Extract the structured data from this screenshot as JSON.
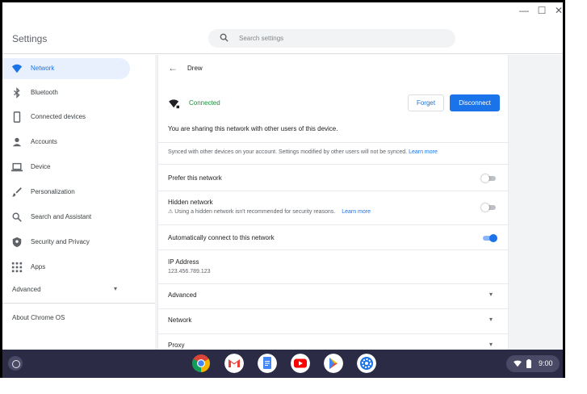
{
  "window": {
    "minimize_glyph": "—",
    "maximize_glyph": "☐",
    "close_glyph": "✕"
  },
  "header": {
    "title": "Settings",
    "search_placeholder": "Search settings"
  },
  "sidebar": {
    "items": [
      {
        "label": "Network",
        "icon": "wifi-icon",
        "active": true
      },
      {
        "label": "Bluetooth",
        "icon": "bluetooth-icon"
      },
      {
        "label": "Connected devices",
        "icon": "phone-icon"
      },
      {
        "label": "Accounts",
        "icon": "person-icon"
      },
      {
        "label": "Device",
        "icon": "laptop-icon"
      },
      {
        "label": "Personalization",
        "icon": "brush-icon"
      },
      {
        "label": "Search and Assistant",
        "icon": "search-icon"
      },
      {
        "label": "Security and Privacy",
        "icon": "shield-icon"
      },
      {
        "label": "Apps",
        "icon": "apps-grid-icon"
      }
    ],
    "advanced_label": "Advanced",
    "about_label": "About Chrome OS"
  },
  "detail": {
    "network_name": "Drew",
    "status": "Connected",
    "forget_label": "Forget",
    "disconnect_label": "Disconnect",
    "sharing_text": "You are sharing this network with other users of this device.",
    "synced_text": "Synced with other devices on your account. Settings modified by other users will not be synced.",
    "learn_more": "Learn more",
    "prefer_label": "Prefer this network",
    "prefer_on": false,
    "hidden_label": "Hidden network",
    "hidden_warning": "Using a hidden network isn't recommended for security reasons.",
    "hidden_on": false,
    "auto_connect_label": "Automatically connect to this network",
    "auto_connect_on": true,
    "ip_label": "IP Address",
    "ip_value": "123.456.789.123",
    "sections": [
      "Advanced",
      "Network",
      "Proxy"
    ]
  },
  "shelf": {
    "apps": [
      "chrome-icon",
      "gmail-icon",
      "docs-icon",
      "youtube-icon",
      "play-store-icon",
      "settings-app-icon"
    ],
    "time": "9:00"
  },
  "colors": {
    "accent": "#1a73e8",
    "connected": "#1e8e3e",
    "shelf": "#2b2b45"
  }
}
